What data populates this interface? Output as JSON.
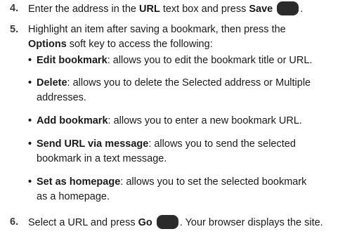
{
  "steps": [
    {
      "number": "4.",
      "parts": {
        "p1": "Enter the address in the ",
        "b1": "URL",
        "p2": " text box and press ",
        "b2": "Save",
        "p3": "."
      }
    },
    {
      "number": "5.",
      "line1": "Highlight an item after saving a bookmark, then press the",
      "b1": "Options",
      "line2_rest": " soft key to access the following:",
      "bullets": [
        {
          "term": "Edit bookmark",
          "desc_line1": ": allows you to edit the bookmark title or URL.",
          "desc_line2": ""
        },
        {
          "term": "Delete",
          "desc_line1": ": allows you to delete the Selected address or Multiple",
          "desc_line2": "addresses."
        },
        {
          "term": "Add bookmark",
          "desc_line1": ": allows you to enter a new bookmark URL.",
          "desc_line2": ""
        },
        {
          "term": "Send URL via message",
          "desc_line1": ": allows you to send the selected",
          "desc_line2": "bookmark in a text message."
        },
        {
          "term": "Set as homepage",
          "desc_line1": ": allows you to set the selected bookmark",
          "desc_line2": "as a homepage."
        }
      ]
    },
    {
      "number": "6.",
      "parts": {
        "p1": "Select a URL and press ",
        "b1": "Go",
        "p2": ". Your browser displays the site."
      }
    }
  ],
  "icons": {
    "key_icon": "soft-key-icon",
    "bullet_symbol": "•"
  },
  "colors": {
    "key_fill": "#2b2b2b",
    "text": "#1a1a1a"
  }
}
